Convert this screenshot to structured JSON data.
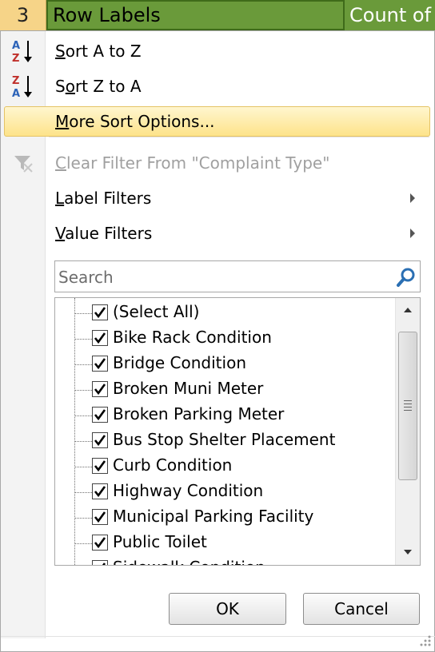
{
  "header": {
    "row_number": "3",
    "column_label": "Row Labels",
    "next_column_label": "Count of"
  },
  "menu": {
    "sort_az": {
      "prefix": "",
      "underline": "S",
      "rest": "ort A to Z"
    },
    "sort_za": {
      "prefix": "S",
      "underline": "o",
      "rest": "rt Z to A"
    },
    "more_sort": {
      "prefix": "",
      "underline": "M",
      "rest": "ore Sort Options..."
    },
    "clear_filter": {
      "prefix": "",
      "underline": "C",
      "rest": "lear Filter From \"Complaint Type\""
    },
    "label_filters": {
      "prefix": "",
      "underline": "L",
      "rest": "abel Filters"
    },
    "value_filters": {
      "prefix": "",
      "underline": "V",
      "rest": "alue Filters"
    }
  },
  "search": {
    "placeholder": "Search"
  },
  "list_items": [
    {
      "label": "(Select All)",
      "checked": true
    },
    {
      "label": "Bike Rack Condition",
      "checked": true
    },
    {
      "label": "Bridge Condition",
      "checked": true
    },
    {
      "label": "Broken Muni Meter",
      "checked": true
    },
    {
      "label": "Broken Parking Meter",
      "checked": true
    },
    {
      "label": "Bus Stop Shelter Placement",
      "checked": true
    },
    {
      "label": "Curb Condition",
      "checked": true
    },
    {
      "label": "Highway Condition",
      "checked": true
    },
    {
      "label": "Municipal Parking Facility",
      "checked": true
    },
    {
      "label": "Public Toilet",
      "checked": true
    },
    {
      "label": "Sidewalk Condition",
      "checked": true
    }
  ],
  "buttons": {
    "ok": "OK",
    "cancel": "Cancel"
  },
  "colors": {
    "header_green": "#6a9a3a",
    "row_number_bg": "#f6d488",
    "highlight": "#fde38a",
    "search_icon": "#2a6fb3"
  }
}
